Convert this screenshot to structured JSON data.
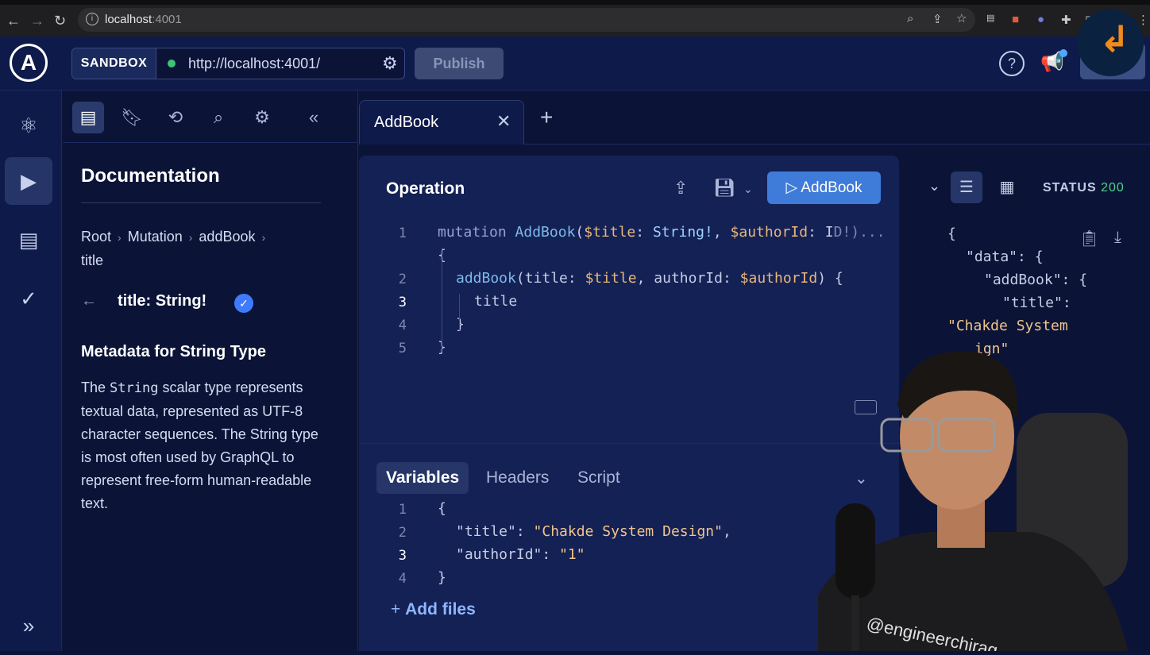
{
  "browser": {
    "host": "localhost",
    "port": ":4001"
  },
  "header": {
    "sandbox_label": "SANDBOX",
    "endpoint": "http://localhost:4001/",
    "publish_label": "Publish",
    "help_label": "?"
  },
  "docs": {
    "title": "Documentation",
    "breadcrumbs": [
      "Root",
      "Mutation",
      "addBook",
      "title"
    ],
    "field": "title: String!",
    "meta_title": "Metadata for String Type",
    "desc_prefix": "The ",
    "desc_code": "String",
    "desc_suffix": " scalar type represents textual data, represented as UTF-8 character sequences. The String type is most often used by GraphQL to represent free-form human-readable text."
  },
  "tabs": [
    {
      "label": "AddBook"
    }
  ],
  "operation": {
    "title": "Operation",
    "run_label": "AddBook",
    "line_numbers": [
      "1",
      "2",
      "3",
      "4",
      "5"
    ],
    "line1_kw": "mutation",
    "line1_fn": "AddBook",
    "line1_open": "(",
    "line1_var1": "$title",
    "line1_colon1": ": ",
    "line1_type1": "String!",
    "line1_comma": ", ",
    "line1_var2": "$authorId",
    "line1_colon2": ": I",
    "line1_ellipsis": "D!)...",
    "line1b": "{",
    "line2_fn": "addBook",
    "line2_a": "(title: ",
    "line2_var1": "$title",
    "line2_b": ", authorId: ",
    "line2_var2": "$authorId",
    "line2_c": ") {",
    "line3": "title",
    "line4": "}",
    "line5": "}"
  },
  "variables": {
    "tabs": [
      "Variables",
      "Headers",
      "Script"
    ],
    "line_numbers": [
      "1",
      "2",
      "3",
      "4"
    ],
    "open": "{",
    "key1": "\"title\"",
    "val1": "\"Chakde System Design\"",
    "key2": "\"authorId\"",
    "val2": "\"1\"",
    "close": "}",
    "add_files": "Add files"
  },
  "response": {
    "status_label": "STATUS",
    "status_code": "200",
    "lines": [
      "{",
      "\"data\": {",
      "\"addBook\": {",
      "\"title\":",
      "\"Chakde System",
      "ign\""
    ]
  },
  "overlay": {
    "watermark": "@engineerchirag"
  },
  "colors": {
    "accent": "#3f7bd9",
    "status_ok": "#4fd38a",
    "string": "#f0c48a"
  }
}
